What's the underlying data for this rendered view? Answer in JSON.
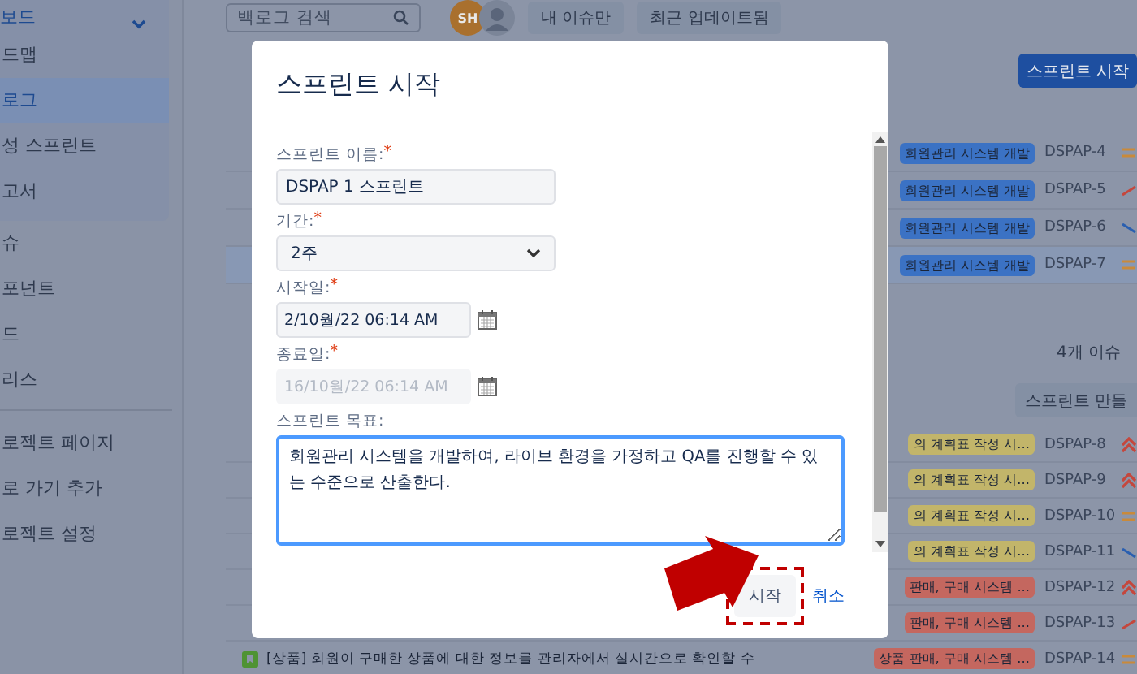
{
  "sidebar": {
    "group": {
      "label": "보드",
      "expanded": true,
      "items": [
        {
          "label": "드맵",
          "selected": false
        },
        {
          "label": "로그",
          "selected": true
        },
        {
          "label": "성 스프린트",
          "selected": false
        },
        {
          "label": "고서",
          "selected": false
        }
      ]
    },
    "items": [
      {
        "label": "슈"
      },
      {
        "label": "포넌트"
      },
      {
        "label": "드"
      },
      {
        "label": "리스"
      }
    ],
    "footer_items": [
      {
        "label": "로젝트 페이지"
      },
      {
        "label": "로 가기 추가"
      },
      {
        "label": "로젝트 설정"
      }
    ]
  },
  "top_bar": {
    "search": {
      "placeholder": "백로그 검색"
    },
    "avatar": "SH",
    "filters": [
      "내 이슈만",
      "최근 업데이트됨"
    ]
  },
  "sprint": {
    "start_button": "스프린트 시작",
    "rows": [
      {
        "kind": "medium",
        "epic": "회원관리 시스템 개발",
        "color": "#3b72c4",
        "key": "DSPAP-4",
        "selected": false
      },
      {
        "kind": "high",
        "epic": "회원관리 시스템 개발",
        "color": "#3b72c4",
        "key": "DSPAP-5",
        "selected": false
      },
      {
        "kind": "low",
        "epic": "회원관리 시스템 개발",
        "color": "#3b72c4",
        "key": "DSPAP-6",
        "selected": false
      },
      {
        "kind": "medium",
        "epic": "회원관리 시스템 개발",
        "color": "#3b72c4",
        "key": "DSPAP-7",
        "selected": true
      }
    ]
  },
  "backlog": {
    "issue_count": "4개 이슈",
    "create_sprint_button": "스프린트 만들",
    "rows": [
      {
        "kind": "highest",
        "epic": "의 계획표 작성 시...",
        "color": "#c2b56a",
        "key": "DSPAP-8"
      },
      {
        "kind": "highest",
        "epic": "의 계획표 작성 시...",
        "color": "#c2b56a",
        "key": "DSPAP-9"
      },
      {
        "kind": "medium",
        "epic": "의 계획표 작성 시...",
        "color": "#c2b56a",
        "key": "DSPAP-10"
      },
      {
        "kind": "low",
        "epic": "의 계획표 작성 시...",
        "color": "#c2b56a",
        "key": "DSPAP-11"
      },
      {
        "kind": "highest",
        "epic": "판매, 구매 시스템 ...",
        "color": "#c4675f",
        "key": "DSPAP-12"
      },
      {
        "kind": "high",
        "epic": "판매, 구매 시스템 ...",
        "color": "#c4675f",
        "key": "DSPAP-13"
      },
      {
        "kind": "medium",
        "summary": "[상품] 회원이 구매한 상품에 대한 정보를 관리자에서 실시간으로 확인할 수",
        "epic": "상품 판매, 구매 시스템 ...",
        "color": "#c4675f",
        "key": "DSPAP-14"
      }
    ]
  },
  "dialog": {
    "title": "스프린트 시작",
    "fields": [
      {
        "kind": "text",
        "label": "스프린트 이름:",
        "required_mark": "*",
        "value": "DSPAP 1 스프린트",
        "disabled": false,
        "focused": false
      },
      {
        "kind": "select",
        "label": "기간:",
        "required_mark": "*",
        "value": "2주",
        "disabled": false,
        "focused": false
      },
      {
        "kind": "date",
        "label": "시작일:",
        "required_mark": "*",
        "value": "2/10월/22 06:14 AM",
        "disabled": false,
        "focused": false
      },
      {
        "kind": "date",
        "label": "종료일:",
        "required_mark": "*",
        "value": "16/10월/22 06:14 AM",
        "disabled": true,
        "focused": false
      },
      {
        "kind": "textarea",
        "label": "스프린트 목표:",
        "value": "회원관리 시스템을 개발하여, 라이브 환경을 가정하고 QA를 진행할 수 있는 수준으로 산출한다.",
        "disabled": false,
        "focused": true
      }
    ],
    "buttons": [
      {
        "kind": "primary",
        "label": "시작",
        "highlighted": true
      },
      {
        "kind": "link",
        "label": "취소",
        "highlighted": false
      }
    ]
  }
}
